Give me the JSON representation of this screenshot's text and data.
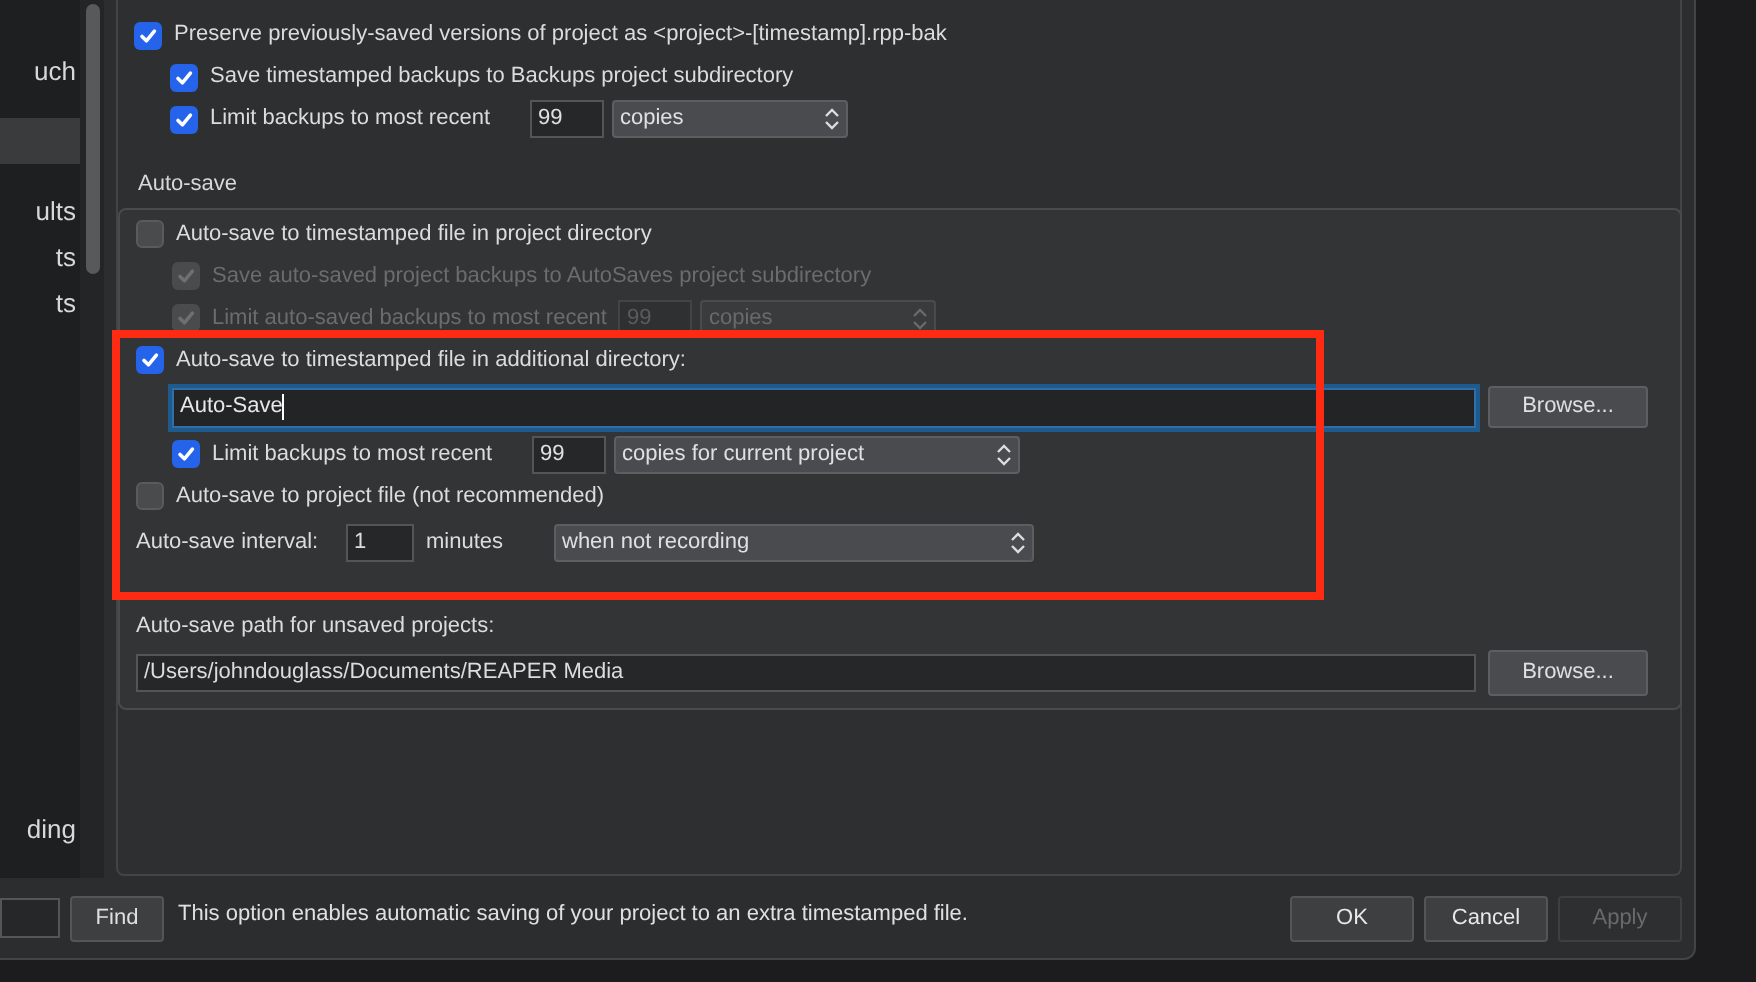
{
  "sidebar": {
    "items": [
      {
        "label": "uch",
        "selected": false
      },
      {
        "selected": true
      },
      {
        "label": "ults",
        "selected": false
      },
      {
        "label": "ts",
        "selected": false
      },
      {
        "label": "ts",
        "selected": false
      },
      {
        "label": "ding",
        "selected": false
      }
    ]
  },
  "backups": [
    {
      "kind": "checkbox",
      "label": "Preserve previously-saved versions of project as <project>-[timestamp].rpp-bak",
      "checked": true,
      "disabled": false,
      "children": [
        {
          "kind": "checkbox",
          "label": "Save timestamped backups to Backups project subdirectory",
          "checked": true,
          "disabled": false
        },
        {
          "kind": "limit",
          "label": "Limit backups to most recent",
          "checked": true,
          "disabled": false,
          "count": "99",
          "unit": "copies"
        }
      ]
    }
  ],
  "autosave": {
    "title": "Auto-save",
    "options": [
      {
        "kind": "checkbox",
        "label": "Auto-save to timestamped file in project directory",
        "checked": false,
        "disabled": false,
        "children": [
          {
            "kind": "checkbox",
            "label": "Save auto-saved project backups to AutoSaves project subdirectory",
            "checked": true,
            "disabled": true
          },
          {
            "kind": "limit",
            "label": "Limit auto-saved backups to most recent",
            "checked": true,
            "disabled": true,
            "count": "99",
            "unit": "copies"
          }
        ]
      },
      {
        "kind": "checkbox",
        "label": "Auto-save to timestamped file in additional directory:",
        "checked": true,
        "disabled": false,
        "children": [
          {
            "kind": "path",
            "value": "Auto-Save",
            "focused": true,
            "button": "Browse..."
          },
          {
            "kind": "limit",
            "label": "Limit backups to most recent",
            "checked": true,
            "disabled": false,
            "count": "99",
            "unit": "copies for current project"
          }
        ]
      },
      {
        "kind": "checkbox",
        "label": "Auto-save to project file (not recommended)",
        "checked": false,
        "disabled": false
      }
    ],
    "interval": {
      "label": "Auto-save interval:",
      "value": "1",
      "unit": "minutes",
      "mode": "when not recording"
    },
    "unsaved_path": {
      "label": "Auto-save path for unsaved projects:",
      "value": "/Users/johndouglass/Documents/REAPER Media",
      "button": "Browse..."
    }
  },
  "find_button": "Find",
  "hint": "This option enables automatic saving of your project to an extra timestamped file.",
  "buttons": [
    {
      "label": "OK",
      "disabled": false
    },
    {
      "label": "Cancel",
      "disabled": false
    },
    {
      "label": "Apply",
      "disabled": true
    }
  ]
}
